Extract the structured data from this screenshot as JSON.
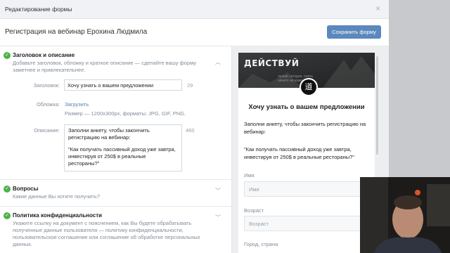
{
  "modal": {
    "title": "Редактирование формы",
    "close": "×"
  },
  "form": {
    "name": "Регистрация на вебинар Ерохина Людмила",
    "save_label": "Сохранить форму"
  },
  "sections": {
    "header": {
      "title": "Заголовок и описание",
      "description": "Добавьте заголовок, обложку и краткое описание — сделайте вашу форму заметнее и привлекательнее.",
      "fields": {
        "title_label": "Заголовок:",
        "title_value": "Хочу узнать о вашем предложении",
        "title_counter": "29",
        "cover_label": "Обложка:",
        "cover_link": "Загрузить",
        "cover_hint": "Размер — 1200x300px, форматы: JPG, GIF, PNG.",
        "desc_label": "Описание:",
        "desc_line1": "Заполни анкету, чтобы закончить регистрацию на вебинар:",
        "desc_line2": "\"Как получать пассивный доход уже завтра, инвестируя от 250$ в реальные рестораны?\"",
        "desc_counter": "460"
      }
    },
    "questions": {
      "title": "Вопросы",
      "description": "Какие данные Вы хотите получить?"
    },
    "privacy": {
      "title": "Политика конфиденциальности",
      "description": "Укажите ссылку на документ с пояснением, как Вы будете обрабатывать полученные данные пользователя — политику конфиденциальности, пользовательское соглашение или соглашение об обработке персональных данных."
    }
  },
  "preview": {
    "cover_text": "ДЕЙСТВУЙ",
    "cover_sub": "лучше сегодня, опять ничего не изменится",
    "logo_glyph": "道",
    "title": "Хочу узнать о вашем предложении",
    "desc": "Заполни анкету, чтобы закончить регистрацию на вебинар:",
    "quote": "\"Как получать пассивный доход уже завтра, инвестируя от 250$ в реальные рестораны?\"",
    "fields": [
      {
        "label": "Имя",
        "placeholder": "Имя"
      },
      {
        "label": "Возраст",
        "placeholder": "Возраст"
      },
      {
        "label": "Город, страна",
        "placeholder": ""
      }
    ]
  },
  "colors": {
    "accent": "#5b88bd",
    "check": "#4bb34b",
    "link": "#5a7fa8"
  }
}
